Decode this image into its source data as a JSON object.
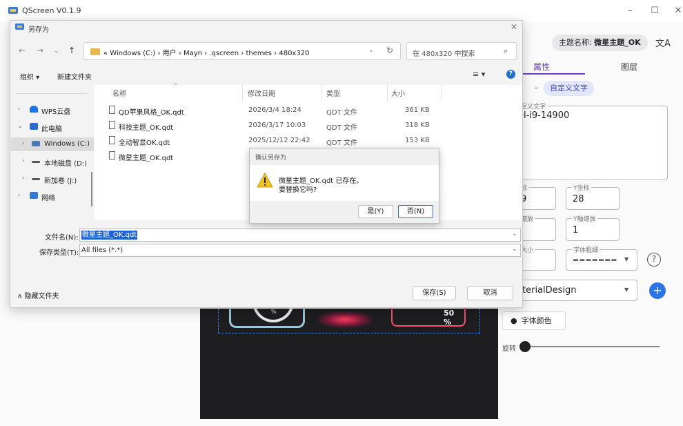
{
  "app": {
    "title": "QScreen V0.1.9",
    "minimize": "–",
    "maximize": "☐",
    "close": "✕"
  },
  "panel": {
    "theme_name_label": "主题名称:",
    "theme_name_value": "微星主题_OK",
    "translate_icon": "文A",
    "tab_properties": "属性",
    "tab_layers": "图层",
    "chip_dash": "-",
    "chip_custom_text": "自定义文字",
    "custom_text_label": "定义文字",
    "custom_text_value": "el-i9-14900",
    "x_coord_label": "标",
    "x_coord_value": "9",
    "y_coord_label": "Y坐标",
    "y_coord_value": "28",
    "x_scale_label": "缩放",
    "y_scale_label": "Y轴缩放",
    "y_scale_value": "1",
    "font_size_label": "大小",
    "font_weight_label": "字体粗细",
    "font_weight_value": "=======",
    "font_family_value": "terialDesign",
    "font_color_button": "字体颜色",
    "rotate_label": "旋转",
    "help": "?",
    "add": "+",
    "rotation_value": 0
  },
  "canvas": {
    "gauge_percent": "50 %",
    "gauge_glyph": "%"
  },
  "save_dialog": {
    "title": "另存为",
    "address_path": "« Windows (C:) › 用户 › Mayn › .qscreen › themes › 480x320",
    "search_placeholder": "在 480x320 中搜索",
    "organize": "组织 ▾",
    "new_folder": "新建文件夹",
    "view_icon": "≡ ▾",
    "help_icon": "?",
    "nav_items": [
      {
        "label": "WPS云盘",
        "chev": "›",
        "color": "#1a73e8"
      },
      {
        "label": "此电脑",
        "chev": "⌄",
        "color": "#2b6cd6"
      },
      {
        "label": "Windows (C:)",
        "chev": "›",
        "color": "#4a78b8"
      },
      {
        "label": "本地磁盘 (D:)",
        "chev": "›",
        "color": "#555555"
      },
      {
        "label": "新加卷 (J:)",
        "chev": "›",
        "color": "#555555"
      },
      {
        "label": "网络",
        "chev": "›",
        "color": "#2f7bd6"
      }
    ],
    "columns": {
      "name": "名称",
      "date": "修改日期",
      "type": "类型",
      "size": "大小"
    },
    "files": [
      {
        "name": "QD苹果风格_OK.qdt",
        "date": "2026/3/4 18:24",
        "type": "QDT 文件",
        "size": "361 KB"
      },
      {
        "name": "科技主题_OK.qdt",
        "date": "2026/3/17 10:03",
        "type": "QDT 文件",
        "size": "318 KB"
      },
      {
        "name": "全动智显OK.qdt",
        "date": "2025/12/12 22:42",
        "type": "QDT 文件",
        "size": "153 KB"
      },
      {
        "name": "微星主题_OK.qdt",
        "date": "",
        "type": "",
        "size": ""
      }
    ],
    "filename_label": "文件名(N):",
    "filename_value": "微星主题_OK.qdt",
    "filetype_label": "保存类型(T):",
    "filetype_value": "All files (*.*)",
    "hide_folders": "∧ 隐藏文件夹",
    "save_button": "保存(S)",
    "cancel_button": "取消"
  },
  "confirm_dialog": {
    "title": "确认另存为",
    "line1": "微星主题_OK.qdt 已存在。",
    "line2": "要替换它吗?",
    "yes_button": "是(Y)",
    "no_button": "否(N)"
  },
  "colors": {
    "accent": "#6a3dc2",
    "primary_blue": "#2a74e8",
    "selection": "#1e63d3",
    "canvas_bg": "#1e1e20"
  }
}
